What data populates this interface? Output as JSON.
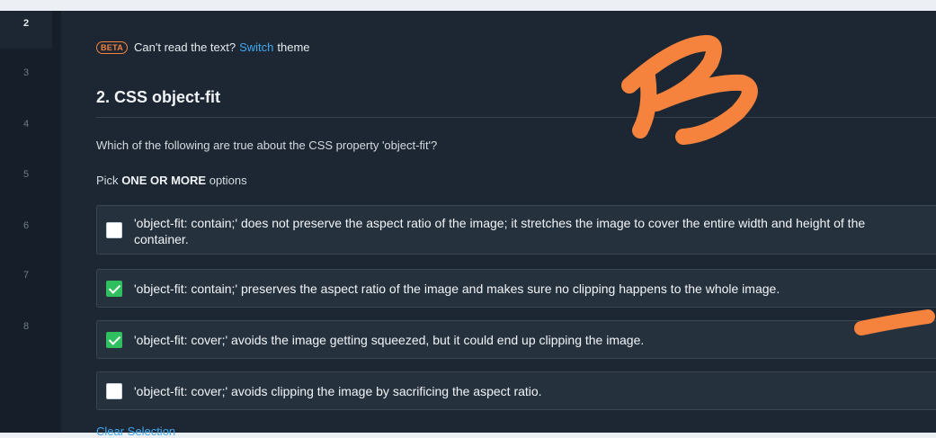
{
  "sidebar": {
    "items": [
      {
        "label": "2",
        "active": true
      },
      {
        "label": "3"
      },
      {
        "label": "4"
      },
      {
        "label": "5"
      },
      {
        "label": "6"
      },
      {
        "label": "7"
      },
      {
        "label": "8"
      }
    ]
  },
  "banner": {
    "badge": "BETA",
    "text": "Can't read the text?",
    "link": "Switch",
    "suffix": "theme"
  },
  "question": {
    "title": "2. CSS object-fit",
    "prompt": "Which of the following are true about the CSS property 'object-fit'?",
    "instruction_prefix": "Pick",
    "instruction_bold": "ONE OR MORE",
    "instruction_suffix": "options",
    "options": [
      {
        "text": "'object-fit: contain;' does not preserve the aspect ratio of the image; it stretches the image to cover the entire width and height of the container.",
        "checked": false
      },
      {
        "text": "'object-fit: contain;' preserves the aspect ratio of the image and makes sure no clipping happens to the whole image.",
        "checked": true
      },
      {
        "text": "'object-fit: cover;' avoids the image getting squeezed, but it could end up clipping the image.",
        "checked": true
      },
      {
        "text": "'object-fit: cover;' avoids clipping the image by sacrificing the aspect ratio.",
        "checked": false
      }
    ],
    "clear_label": "Clear Selection"
  },
  "colors": {
    "accent_orange": "#f5823d",
    "link_blue": "#3ea8f0",
    "check_green": "#2fbf5f"
  }
}
